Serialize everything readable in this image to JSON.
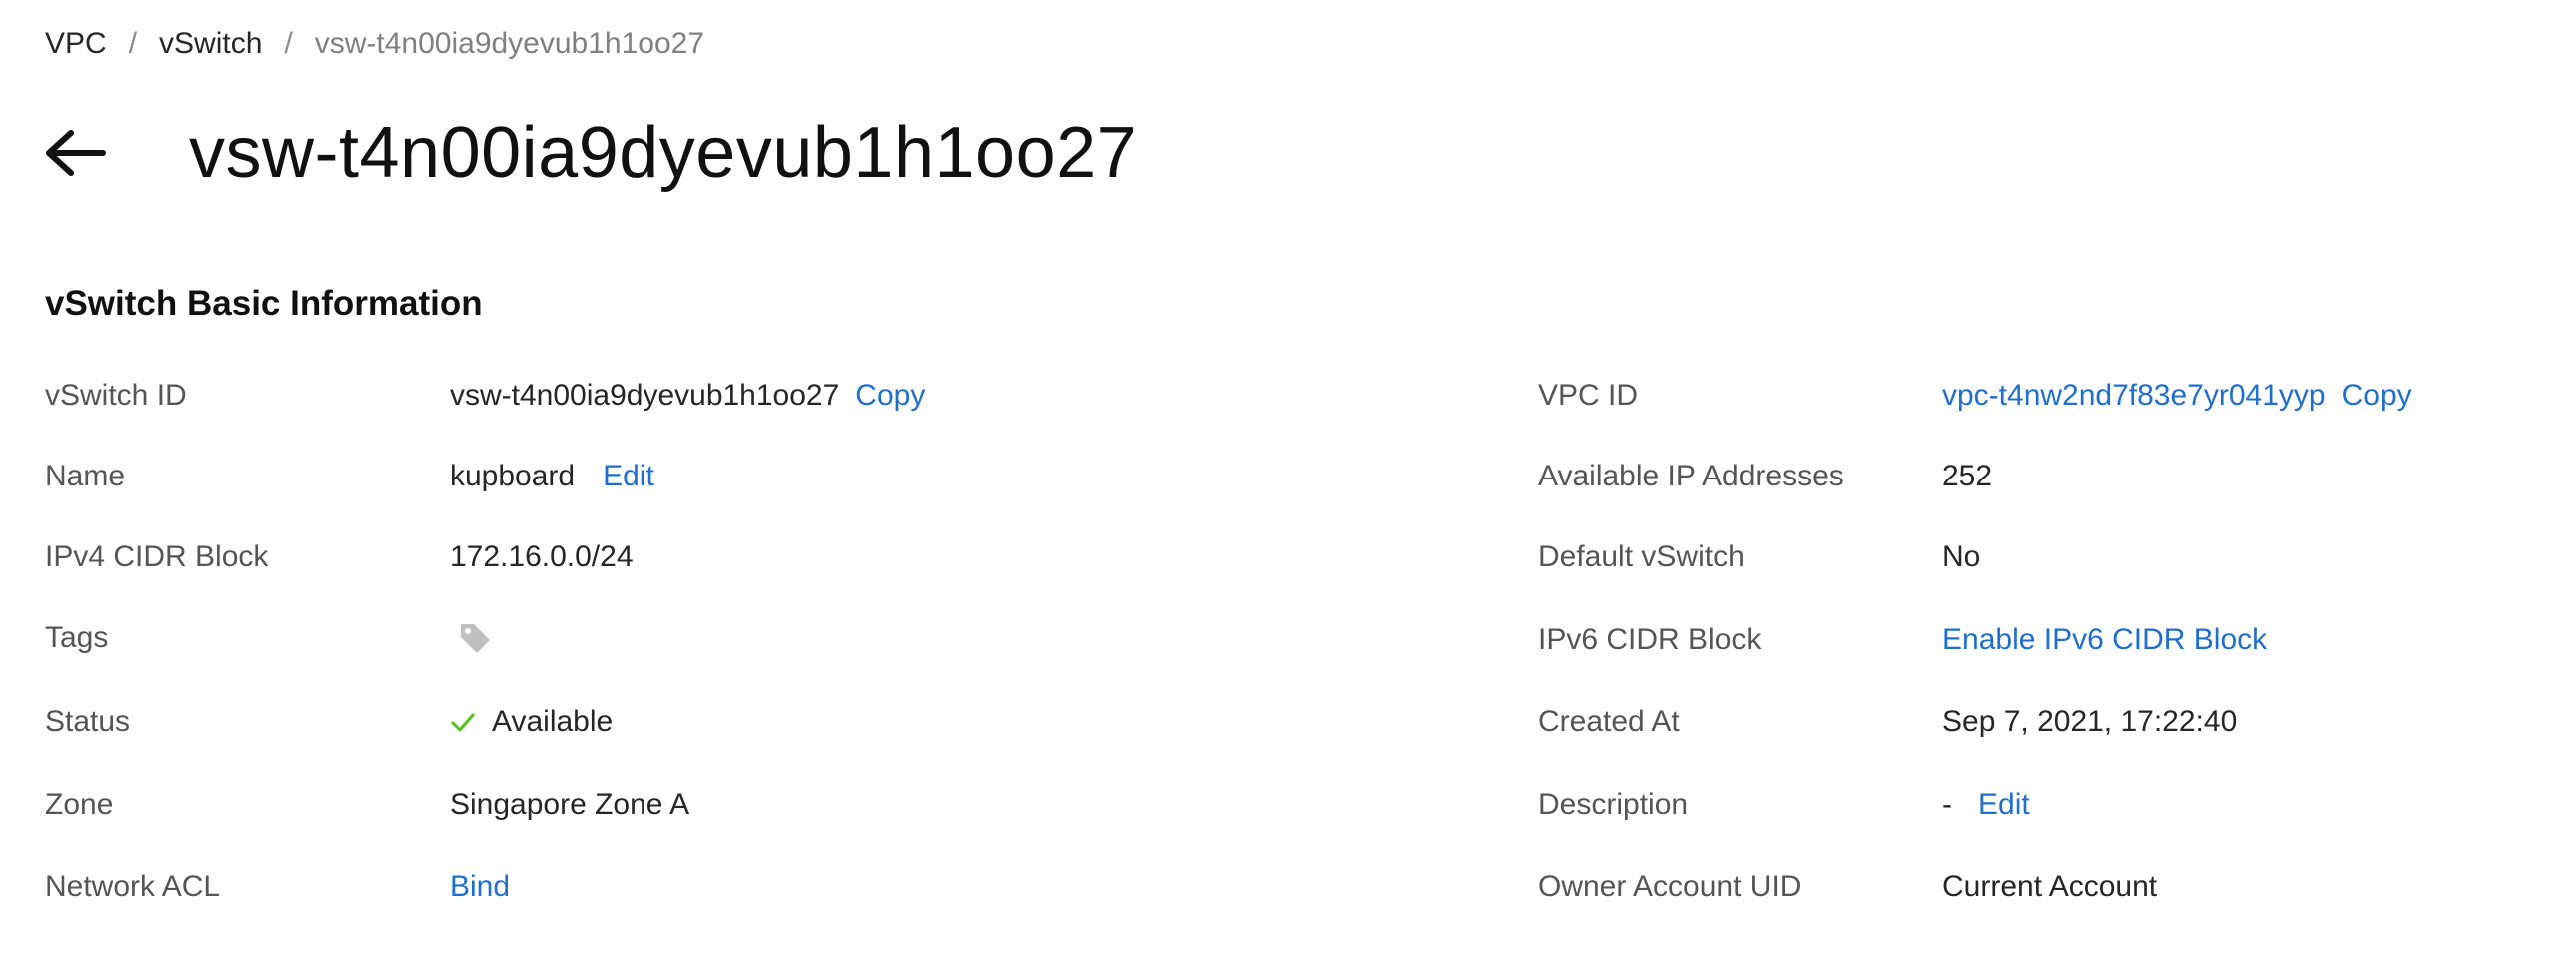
{
  "breadcrumb": {
    "items": [
      "VPC",
      "vSwitch"
    ],
    "separator": "/",
    "current": "vsw-t4n00ia9dyevub1h1oo27"
  },
  "header": {
    "title": "vsw-t4n00ia9dyevub1h1oo27",
    "back_icon": "arrow-left-icon"
  },
  "section": {
    "title": "vSwitch Basic Information"
  },
  "left": {
    "vswitch_id": {
      "label": "vSwitch ID",
      "value": "vsw-t4n00ia9dyevub1h1oo27",
      "action": "Copy"
    },
    "name": {
      "label": "Name",
      "value": "kupboard",
      "action": "Edit"
    },
    "ipv4": {
      "label": "IPv4 CIDR Block",
      "value": "172.16.0.0/24"
    },
    "tags": {
      "label": "Tags",
      "icon": "tag-icon"
    },
    "status": {
      "label": "Status",
      "value": "Available",
      "icon": "check-icon"
    },
    "zone": {
      "label": "Zone",
      "value": "Singapore Zone A"
    },
    "acl": {
      "label": "Network ACL",
      "action": "Bind"
    }
  },
  "right": {
    "vpc_id": {
      "label": "VPC ID",
      "value": "vpc-t4nw2nd7f83e7yr041yyp",
      "action": "Copy"
    },
    "available_ips": {
      "label": "Available IP Addresses",
      "value": "252"
    },
    "default_vswitch": {
      "label": "Default vSwitch",
      "value": "No"
    },
    "ipv6": {
      "label": "IPv6 CIDR Block",
      "action": "Enable IPv6 CIDR Block"
    },
    "created_at": {
      "label": "Created At",
      "value": "Sep 7, 2021, 17:22:40"
    },
    "description": {
      "label": "Description",
      "value": "-",
      "action": "Edit"
    },
    "owner_uid": {
      "label": "Owner Account UID",
      "value": "Current Account"
    }
  },
  "colors": {
    "link": "#1f6fd0",
    "status_ok": "#52c41a",
    "label": "#555555",
    "icon_gray": "#bfbfbf"
  }
}
